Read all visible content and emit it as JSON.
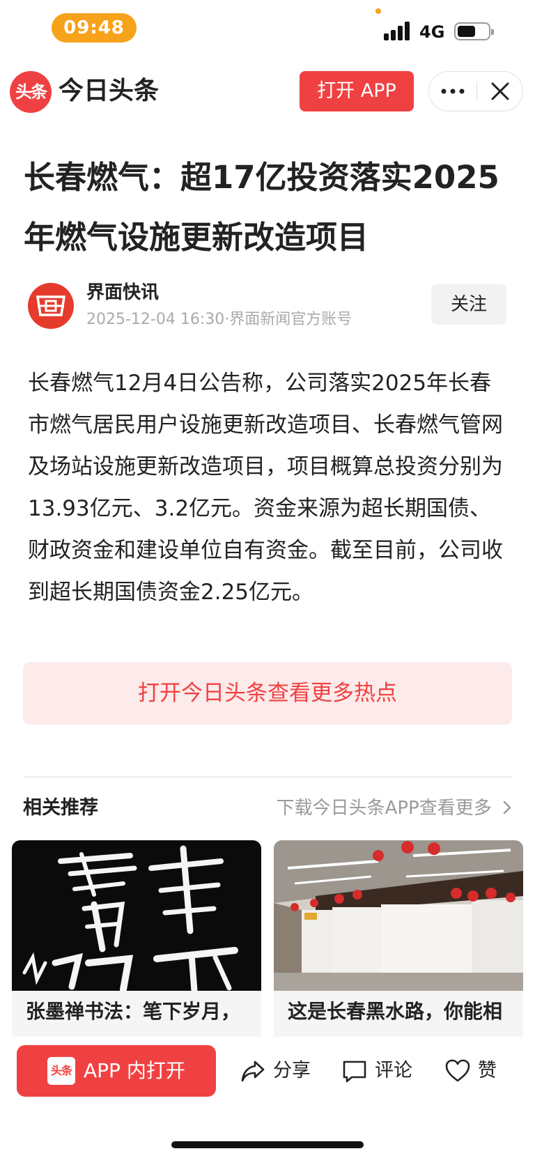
{
  "status_bar": {
    "time": "09:48",
    "network": "4G",
    "battery_level": 0.6
  },
  "header": {
    "logo_text": "头条",
    "app_name": "今日头条",
    "open_app_label": "打开 APP",
    "more_icon": "more-dots-icon",
    "close_icon": "close-icon"
  },
  "article": {
    "title": "长春燃气：超17亿投资落实2025年燃气设施更新改造项目",
    "author": {
      "name": "界面快讯",
      "meta": "2025-12-04 16:30·界面新闻官方账号",
      "follow_label": "关注"
    },
    "body": "长春燃气12月4日公告称，公司落实2025年长春市燃气居民用户设施更新改造项目、长春燃气管网及场站设施更新改造项目，项目概算总投资分别为13.93亿元、3.2亿元。资金来源为超长期国债、财政资金和建设单位自有资金。截至目前，公司收到超长期国债资金2.25亿元。",
    "more_hot_label": "打开今日头条查看更多热点"
  },
  "recommend": {
    "title": "相关推荐",
    "more_label": "下载今日头条APP查看更多",
    "cards": [
      {
        "caption": "张墨禅书法：笔下岁月，"
      },
      {
        "caption": "这是长春黑水路，你能相"
      }
    ]
  },
  "bottom_bar": {
    "open_in_app_label": "APP 内打开",
    "mini_logo_text": "头条",
    "share_label": "分享",
    "comment_label": "评论",
    "like_label": "赞"
  },
  "colors": {
    "brand_red": "#f04142",
    "time_pill": "#f7a21b",
    "pink_bg": "#fdeaea"
  }
}
